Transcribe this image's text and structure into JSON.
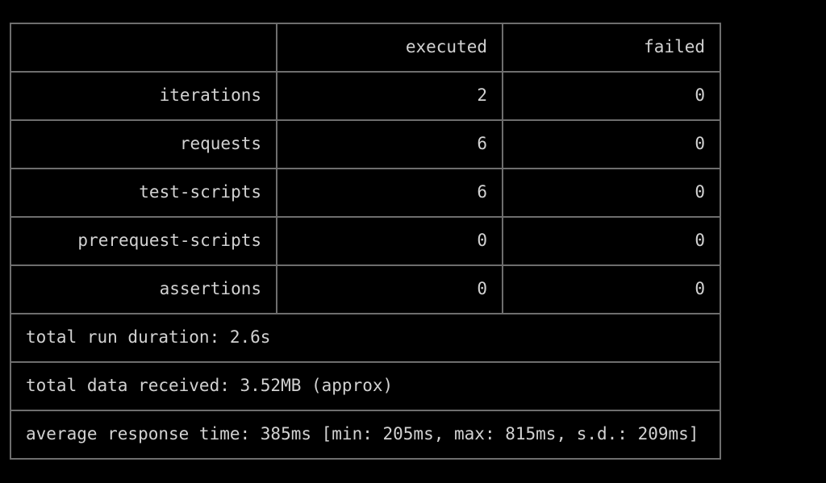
{
  "terminal": {
    "background_color": "#000000",
    "text_color": "#d2d2d2",
    "accent_color": "#1fa01f",
    "border_color": "#6e6e6e"
  },
  "summary": {
    "corner_label": "",
    "columns": [
      {
        "key": "executed",
        "label": "executed"
      },
      {
        "key": "failed",
        "label": "failed"
      }
    ],
    "rows": [
      {
        "label": "iterations",
        "executed": "2",
        "failed": "0"
      },
      {
        "label": "requests",
        "executed": "6",
        "failed": "0"
      },
      {
        "label": "test-scripts",
        "executed": "6",
        "failed": "0"
      },
      {
        "label": "prerequest-scripts",
        "executed": "0",
        "failed": "0"
      },
      {
        "label": "assertions",
        "executed": "0",
        "failed": "0"
      }
    ],
    "footers": [
      {
        "key": "run_duration",
        "text": "total run duration: 2.6s"
      },
      {
        "key": "data_received",
        "text": "total data received: 3.52MB (approx)"
      },
      {
        "key": "avg_response_time",
        "text": "average response time: 385ms [min: 205ms, max: 815ms, s.d.: 209ms]"
      }
    ]
  }
}
